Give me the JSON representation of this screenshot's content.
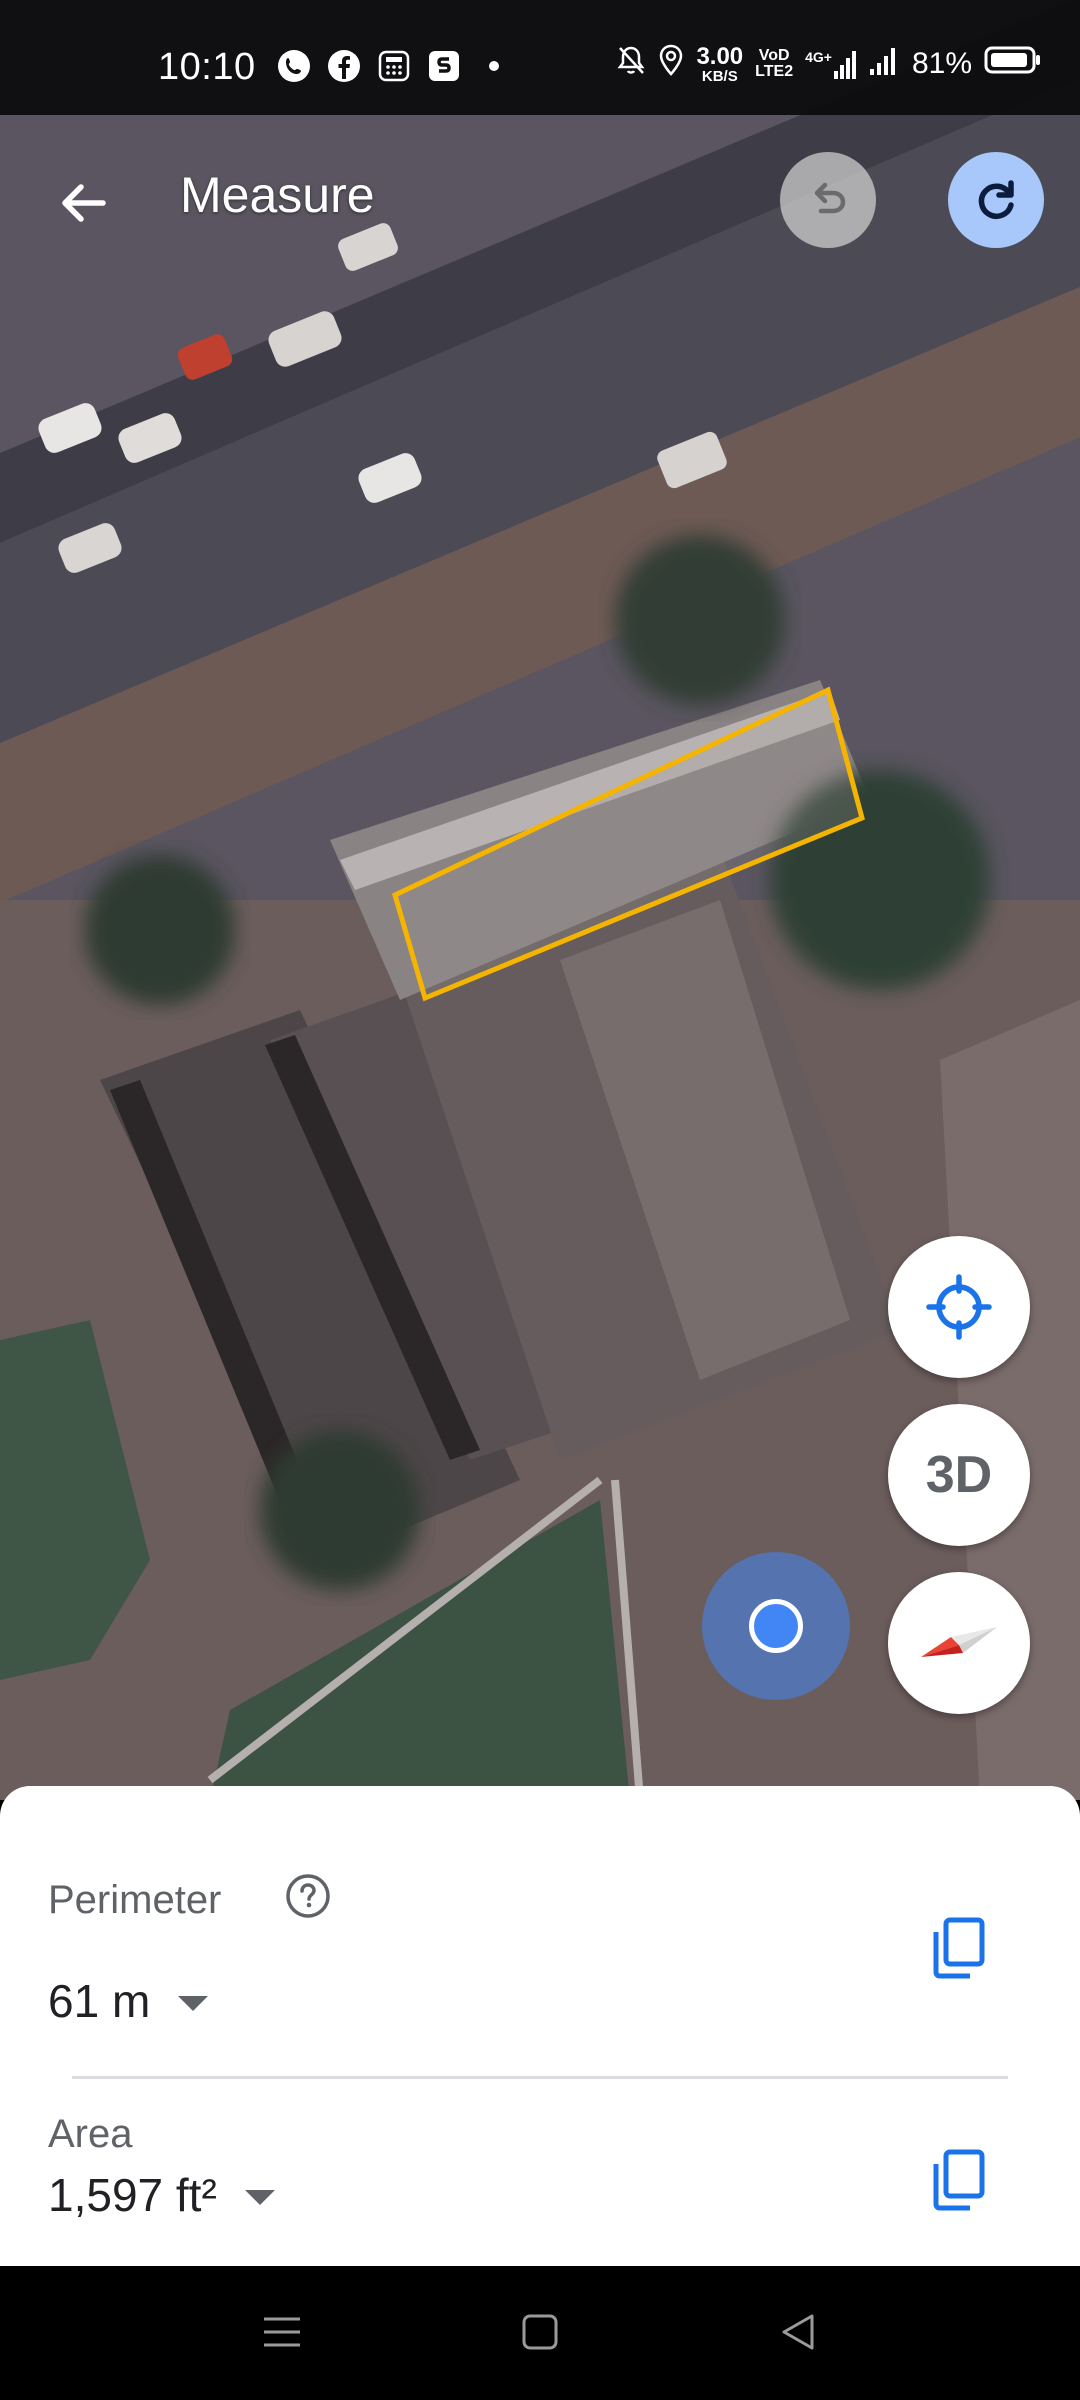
{
  "status_bar": {
    "time": "10:10",
    "app_icons": [
      "phone-icon",
      "facebook-icon",
      "calculator-icon",
      "s-app-icon",
      "dot-icon"
    ],
    "speed_value": "3.00",
    "speed_unit": "KB/S",
    "volte_top": "VoD",
    "volte_bottom": "LTE2",
    "network": "4G+",
    "battery_percent": "81%"
  },
  "app_bar": {
    "title": "Measure",
    "back_icon": "arrow-left-icon",
    "undo_icon": "undo-icon",
    "redo_icon": "redo-icon"
  },
  "map_controls": {
    "location_icon": "my-location-icon",
    "three_d_label": "3D",
    "compass_icon": "compass-icon"
  },
  "measurement": {
    "perimeter_label": "Perimeter",
    "perimeter_value": "61 m",
    "area_label": "Area",
    "area_value": "1,597 ft²"
  },
  "colors": {
    "accent_blue": "#4285f4",
    "copy_icon_blue": "#1a73e8",
    "shape_outline": "#f4b400",
    "redo_bg": "#a8c7fa"
  }
}
